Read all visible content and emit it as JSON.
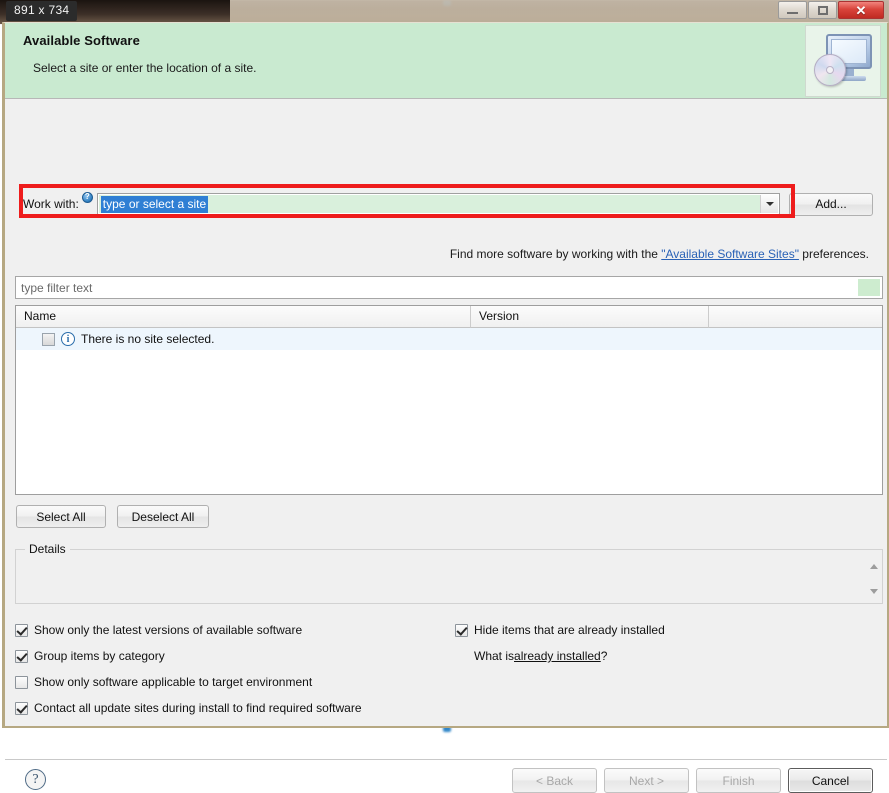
{
  "screen": {
    "size_badge": "891 x 734"
  },
  "titlebar": {
    "minimize_tooltip": "Minimize",
    "maximize_tooltip": "Maximize",
    "close_tooltip": "Close"
  },
  "banner": {
    "title": "Available Software",
    "subtitle": "Select a site or enter the location of a site.",
    "icon": "computer-disc-icon"
  },
  "work_with": {
    "label": "Work with:",
    "info_icon": "info-icon",
    "combo_value": "type or select a site",
    "combo_placeholder": "type or select a site",
    "dropdown_icon": "chevron-down-icon",
    "add_button": "Add..."
  },
  "find_more": {
    "prefix": "Find more software by working with the ",
    "link": "\"Available Software Sites\"",
    "suffix": " preferences."
  },
  "filter": {
    "placeholder": "type filter text",
    "value": ""
  },
  "table": {
    "columns": [
      "Name",
      "Version",
      ""
    ],
    "rows": [
      {
        "checked": false,
        "icon": "info-icon",
        "name": "There is no site selected.",
        "version": ""
      }
    ]
  },
  "selection_buttons": {
    "select_all": "Select All",
    "deselect_all": "Deselect All"
  },
  "details": {
    "legend": "Details",
    "content": "",
    "scroll_up_icon": "scroll-up-icon",
    "scroll_down_icon": "scroll-down-icon"
  },
  "options": {
    "left": [
      {
        "label": "Show only the latest versions of available software",
        "checked": true
      },
      {
        "label": "Group items by category",
        "checked": true
      },
      {
        "label": "Show only software applicable to target environment",
        "checked": false
      },
      {
        "label": "Contact all update sites during install to find required software",
        "checked": true
      }
    ],
    "right": [
      {
        "label": "Hide items that are already installed",
        "checked": true
      }
    ],
    "what_is": {
      "prefix": "What is ",
      "link": "already installed",
      "suffix": "?"
    }
  },
  "footer": {
    "help_icon": "help-icon",
    "buttons": [
      {
        "label": "< Back",
        "enabled": false
      },
      {
        "label": "Next >",
        "enabled": false
      },
      {
        "label": "Finish",
        "enabled": false
      },
      {
        "label": "Cancel",
        "enabled": true
      }
    ]
  },
  "colors": {
    "banner_green": "#c9ead0",
    "highlight_red": "#ee1c1c",
    "selection_blue": "#2f7fd4",
    "link_blue": "#2a62b6",
    "dialog_bg": "#f0f0f0",
    "combo_green": "#d9f0dc"
  }
}
